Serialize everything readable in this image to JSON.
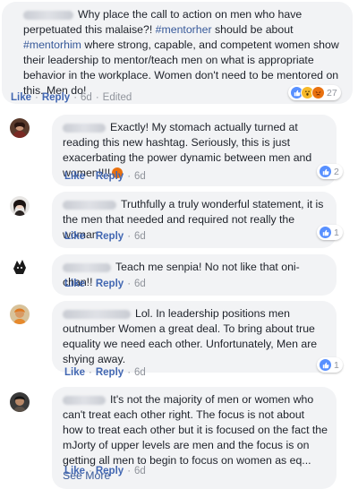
{
  "post": {
    "text_before": "Why place the call to action on men who have perpetuated this malaise?! ",
    "tag1": "#mentorher",
    "text_middle": " should be about ",
    "tag2": "#mentorhim",
    "text_after": " where strong, capable, and competent women show their leadership to mentor/teach men on what is appropriate behavior in the workplace. Women don't need to be mentored on this. Men do!",
    "like_label": "Like",
    "reply_label": "Reply",
    "time": "6d",
    "edited_label": "Edited",
    "reaction_count": "27"
  },
  "replies": [
    {
      "text": "Exactly! My stomach actually turned at reading this new hashtag. Seriously, this is just exacerbating the power dynamic between men and women!!!!",
      "like_label": "Like",
      "reply_label": "Reply",
      "time": "6d",
      "reaction_count": "2"
    },
    {
      "text": "Truthfully a truly wonderful statement, it is the men that needed and required not really the woman",
      "like_label": "Like",
      "reply_label": "Reply",
      "time": "6d",
      "reaction_count": "1"
    },
    {
      "text": "Teach me senpia! No not like that oni-chan!!",
      "like_label": "Like",
      "reply_label": "Reply",
      "time": "6d"
    },
    {
      "text": "Lol. In leadership positions men outnumber Women a great deal. To bring about true equality we need each other. Unfortunately, Men are shying away.",
      "like_label": "Like",
      "reply_label": "Reply",
      "time": "6d",
      "reaction_count": "1"
    },
    {
      "text": "It's not the majority of men or women who can't treat each other right. The focus is not about how to treat each other but it is focused on the fact the mJorty of upper levels are men and the focus is on getting all men to begin to focus on women as eq...",
      "see_more": "See More",
      "like_label": "Like",
      "reply_label": "Reply",
      "time": "6d"
    }
  ],
  "colors": {
    "link": "#4267b2",
    "hashtag": "#365899",
    "bubble": "#f2f3f5",
    "meta": "#90949c",
    "like_blue": "#5890ff"
  }
}
